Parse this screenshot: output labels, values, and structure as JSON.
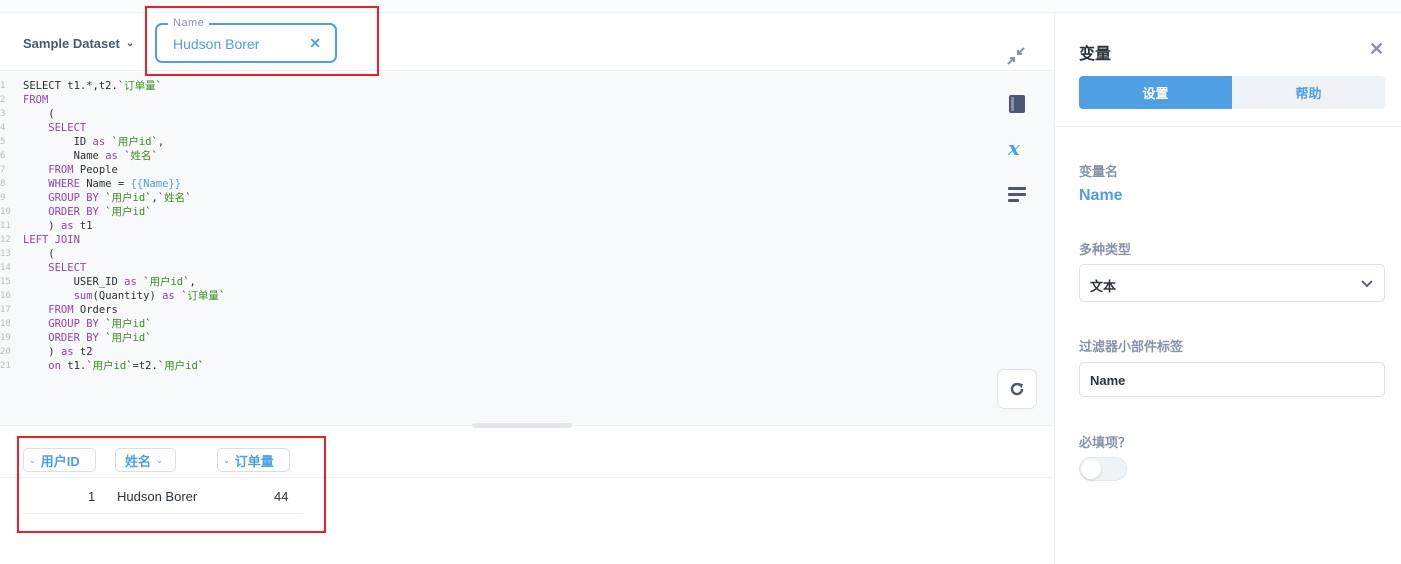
{
  "header": {
    "database": "Sample Dataset",
    "name_widget": {
      "label": "Name",
      "value": "Hudson Borer"
    }
  },
  "editor": {
    "lines": [
      {
        "n": "1",
        "segs": [
          {
            "c": "plain",
            "t": "SELECT t1.*,t2.`"
          },
          {
            "c": "str",
            "t": "订单量"
          },
          {
            "c": "plain",
            "t": "`"
          }
        ]
      },
      {
        "n": "2",
        "segs": [
          {
            "c": "kw",
            "t": "FROM"
          }
        ]
      },
      {
        "n": "3",
        "segs": [
          {
            "c": "plain",
            "t": "    ("
          }
        ]
      },
      {
        "n": "4",
        "segs": [
          {
            "c": "kw",
            "t": "    SELECT"
          }
        ]
      },
      {
        "n": "5",
        "segs": [
          {
            "c": "plain",
            "t": "        ID "
          },
          {
            "c": "kw",
            "t": "as"
          },
          {
            "c": "plain",
            "t": " `"
          },
          {
            "c": "str",
            "t": "用户id"
          },
          {
            "c": "plain",
            "t": "`,"
          }
        ]
      },
      {
        "n": "6",
        "segs": [
          {
            "c": "plain",
            "t": "        Name "
          },
          {
            "c": "kw",
            "t": "as"
          },
          {
            "c": "plain",
            "t": " `"
          },
          {
            "c": "str",
            "t": "姓名"
          },
          {
            "c": "plain",
            "t": "`"
          }
        ]
      },
      {
        "n": "7",
        "segs": [
          {
            "c": "kw",
            "t": "    FROM"
          },
          {
            "c": "plain",
            "t": " People"
          }
        ]
      },
      {
        "n": "8",
        "segs": [
          {
            "c": "kw",
            "t": "    WHERE"
          },
          {
            "c": "plain",
            "t": " Name = "
          },
          {
            "c": "var",
            "t": "{{Name}}"
          }
        ]
      },
      {
        "n": "9",
        "segs": [
          {
            "c": "kw",
            "t": "    GROUP BY"
          },
          {
            "c": "plain",
            "t": " `"
          },
          {
            "c": "str",
            "t": "用户id"
          },
          {
            "c": "plain",
            "t": "`,`"
          },
          {
            "c": "str",
            "t": "姓名"
          },
          {
            "c": "plain",
            "t": "`"
          }
        ]
      },
      {
        "n": "10",
        "segs": [
          {
            "c": "kw",
            "t": "    ORDER BY"
          },
          {
            "c": "plain",
            "t": " `"
          },
          {
            "c": "str",
            "t": "用户id"
          },
          {
            "c": "plain",
            "t": "`"
          }
        ]
      },
      {
        "n": "11",
        "segs": [
          {
            "c": "plain",
            "t": "    ) "
          },
          {
            "c": "kw",
            "t": "as"
          },
          {
            "c": "plain",
            "t": " t1"
          }
        ]
      },
      {
        "n": "12",
        "segs": [
          {
            "c": "kw",
            "t": "LEFT JOIN"
          }
        ]
      },
      {
        "n": "13",
        "segs": [
          {
            "c": "plain",
            "t": "    ("
          }
        ]
      },
      {
        "n": "14",
        "segs": [
          {
            "c": "kw",
            "t": "    SELECT"
          }
        ]
      },
      {
        "n": "15",
        "segs": [
          {
            "c": "plain",
            "t": "        USER_ID "
          },
          {
            "c": "kw",
            "t": "as"
          },
          {
            "c": "plain",
            "t": " `"
          },
          {
            "c": "str",
            "t": "用户id"
          },
          {
            "c": "plain",
            "t": "`,"
          }
        ]
      },
      {
        "n": "16",
        "segs": [
          {
            "c": "kw",
            "t": "        sum"
          },
          {
            "c": "plain",
            "t": "(Quantity) "
          },
          {
            "c": "kw",
            "t": "as"
          },
          {
            "c": "plain",
            "t": " `"
          },
          {
            "c": "str",
            "t": "订单量"
          },
          {
            "c": "plain",
            "t": "`"
          }
        ]
      },
      {
        "n": "17",
        "segs": [
          {
            "c": "kw",
            "t": "    FROM"
          },
          {
            "c": "plain",
            "t": " Orders"
          }
        ]
      },
      {
        "n": "18",
        "segs": [
          {
            "c": "kw",
            "t": "    GROUP BY"
          },
          {
            "c": "plain",
            "t": " `"
          },
          {
            "c": "str",
            "t": "用户id"
          },
          {
            "c": "plain",
            "t": "`"
          }
        ]
      },
      {
        "n": "19",
        "segs": [
          {
            "c": "kw",
            "t": "    ORDER BY"
          },
          {
            "c": "plain",
            "t": " `"
          },
          {
            "c": "str",
            "t": "用户id"
          },
          {
            "c": "plain",
            "t": "`"
          }
        ]
      },
      {
        "n": "20",
        "segs": [
          {
            "c": "plain",
            "t": "    ) "
          },
          {
            "c": "kw",
            "t": "as"
          },
          {
            "c": "plain",
            "t": " t2"
          }
        ]
      },
      {
        "n": "21",
        "segs": [
          {
            "c": "kw",
            "t": "    on"
          },
          {
            "c": "plain",
            "t": " t1.`"
          },
          {
            "c": "str",
            "t": "用户id"
          },
          {
            "c": "plain",
            "t": "`=t2.`"
          },
          {
            "c": "str",
            "t": "用户id"
          },
          {
            "c": "plain",
            "t": "`"
          }
        ]
      }
    ]
  },
  "results": {
    "columns": [
      "用户ID",
      "姓名",
      "订单量"
    ],
    "rows": [
      [
        "1",
        "Hudson Borer",
        "44"
      ]
    ]
  },
  "sidebar": {
    "title": "变量",
    "tabs": [
      "设置",
      "帮助"
    ],
    "var_name_label": "变量名",
    "var_name": "Name",
    "type_label": "多种类型",
    "type_value": "文本",
    "widget_label_label": "过滤器小部件标签",
    "widget_label_value": "Name",
    "required_label": "必填项？"
  },
  "colors": {
    "brand": "#509ee3",
    "highlight_box": "#e8202a"
  }
}
